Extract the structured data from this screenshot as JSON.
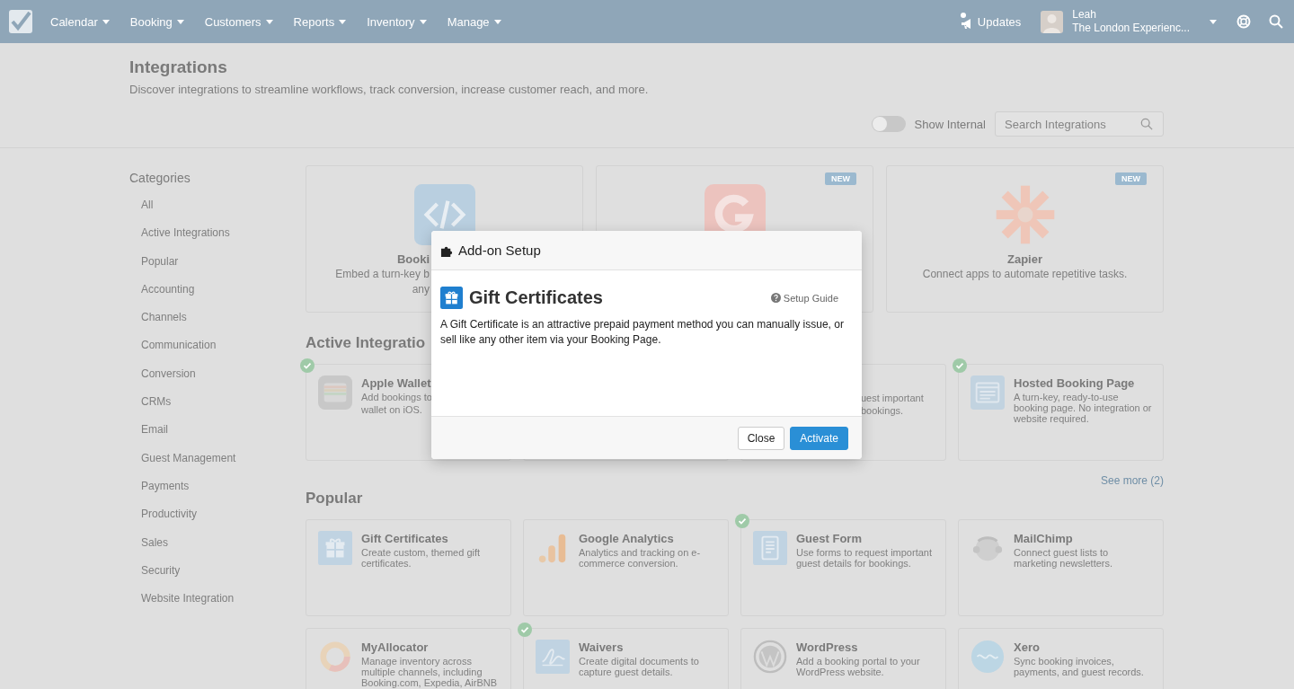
{
  "nav": {
    "menu": [
      "Calendar",
      "Booking",
      "Customers",
      "Reports",
      "Inventory",
      "Manage"
    ],
    "updates": "Updates",
    "user": {
      "name": "Leah",
      "account": "The London Experienc..."
    }
  },
  "header": {
    "title": "Integrations",
    "subtitle": "Discover integrations to streamline workflows, track conversion, increase customer reach, and more.",
    "show_internal": {
      "label": "Show Internal",
      "on": false
    },
    "search": {
      "placeholder": "Search Integrations"
    }
  },
  "sidebar": {
    "heading": "Categories",
    "items": [
      "All",
      "Active Integrations",
      "Popular",
      "Accounting",
      "Channels",
      "Communication",
      "Conversion",
      "CRMs",
      "Email",
      "Guest Management",
      "Payments",
      "Productivity",
      "Sales",
      "Security",
      "Website Integration"
    ]
  },
  "featured": [
    {
      "kind": "covered-right",
      "title": "Booki",
      "description": [
        "Embed a turn-key b",
        "any"
      ]
    },
    {
      "kind": "hidden",
      "badge": "NEW"
    },
    {
      "kind": "full",
      "badge": "NEW",
      "title": "Zapier",
      "description": [
        "Connect apps to automate repetitive tasks."
      ]
    }
  ],
  "active": {
    "heading": "Active Integratio",
    "cards": [
      {
        "kind": "covered-right",
        "active": true,
        "title": "Apple Wallet",
        "description": [
          "Add bookings to",
          "wallet on iOS."
        ]
      },
      {
        "kind": "hidden"
      },
      {
        "kind": "covered-left",
        "description": [
          "uest important",
          "bookings."
        ]
      },
      {
        "kind": "full",
        "active": true,
        "title": "Hosted Booking Page",
        "description": [
          "A turn-key, ready-to-use booking page. No integration or website required."
        ]
      }
    ],
    "see_more": "See more (2)"
  },
  "popular": {
    "heading": "Popular",
    "cards": [
      {
        "kind": "full",
        "active": false,
        "title": "Gift Certificates",
        "description": [
          "Create custom, themed gift certificates."
        ]
      },
      {
        "kind": "full",
        "active": false,
        "title": "Google Analytics",
        "description": [
          "Analytics and tracking on e-commerce conversion."
        ]
      },
      {
        "kind": "full",
        "active": true,
        "title": "Guest Form",
        "description": [
          "Use forms to request important guest details for bookings."
        ]
      },
      {
        "kind": "full",
        "active": false,
        "title": "MailChimp",
        "description": [
          "Connect guest lists to marketing newsletters."
        ]
      },
      {
        "kind": "full",
        "active": false,
        "title": "MyAllocator",
        "description": [
          "Manage inventory across multiple channels, including Booking.com, Expedia, AirBNB"
        ]
      },
      {
        "kind": "full",
        "active": true,
        "title": "Waivers",
        "description": [
          "Create digital documents to capture guest details."
        ]
      },
      {
        "kind": "full",
        "active": false,
        "title": "WordPress",
        "description": [
          "Add a booking portal to your WordPress website."
        ]
      },
      {
        "kind": "full",
        "active": false,
        "title": "Xero",
        "description": [
          "Sync booking invoices, payments, and guest records."
        ]
      }
    ]
  },
  "modal": {
    "title": "Add-on Setup",
    "addon": "Gift Certificates",
    "guide": "Setup Guide",
    "description": "A Gift Certificate is an attractive prepaid payment method you can manually issue, or sell like any other item via your Booking Page.",
    "buttons": [
      {
        "label": "Close",
        "kind": "default"
      },
      {
        "label": "Activate",
        "kind": "primary"
      }
    ]
  }
}
